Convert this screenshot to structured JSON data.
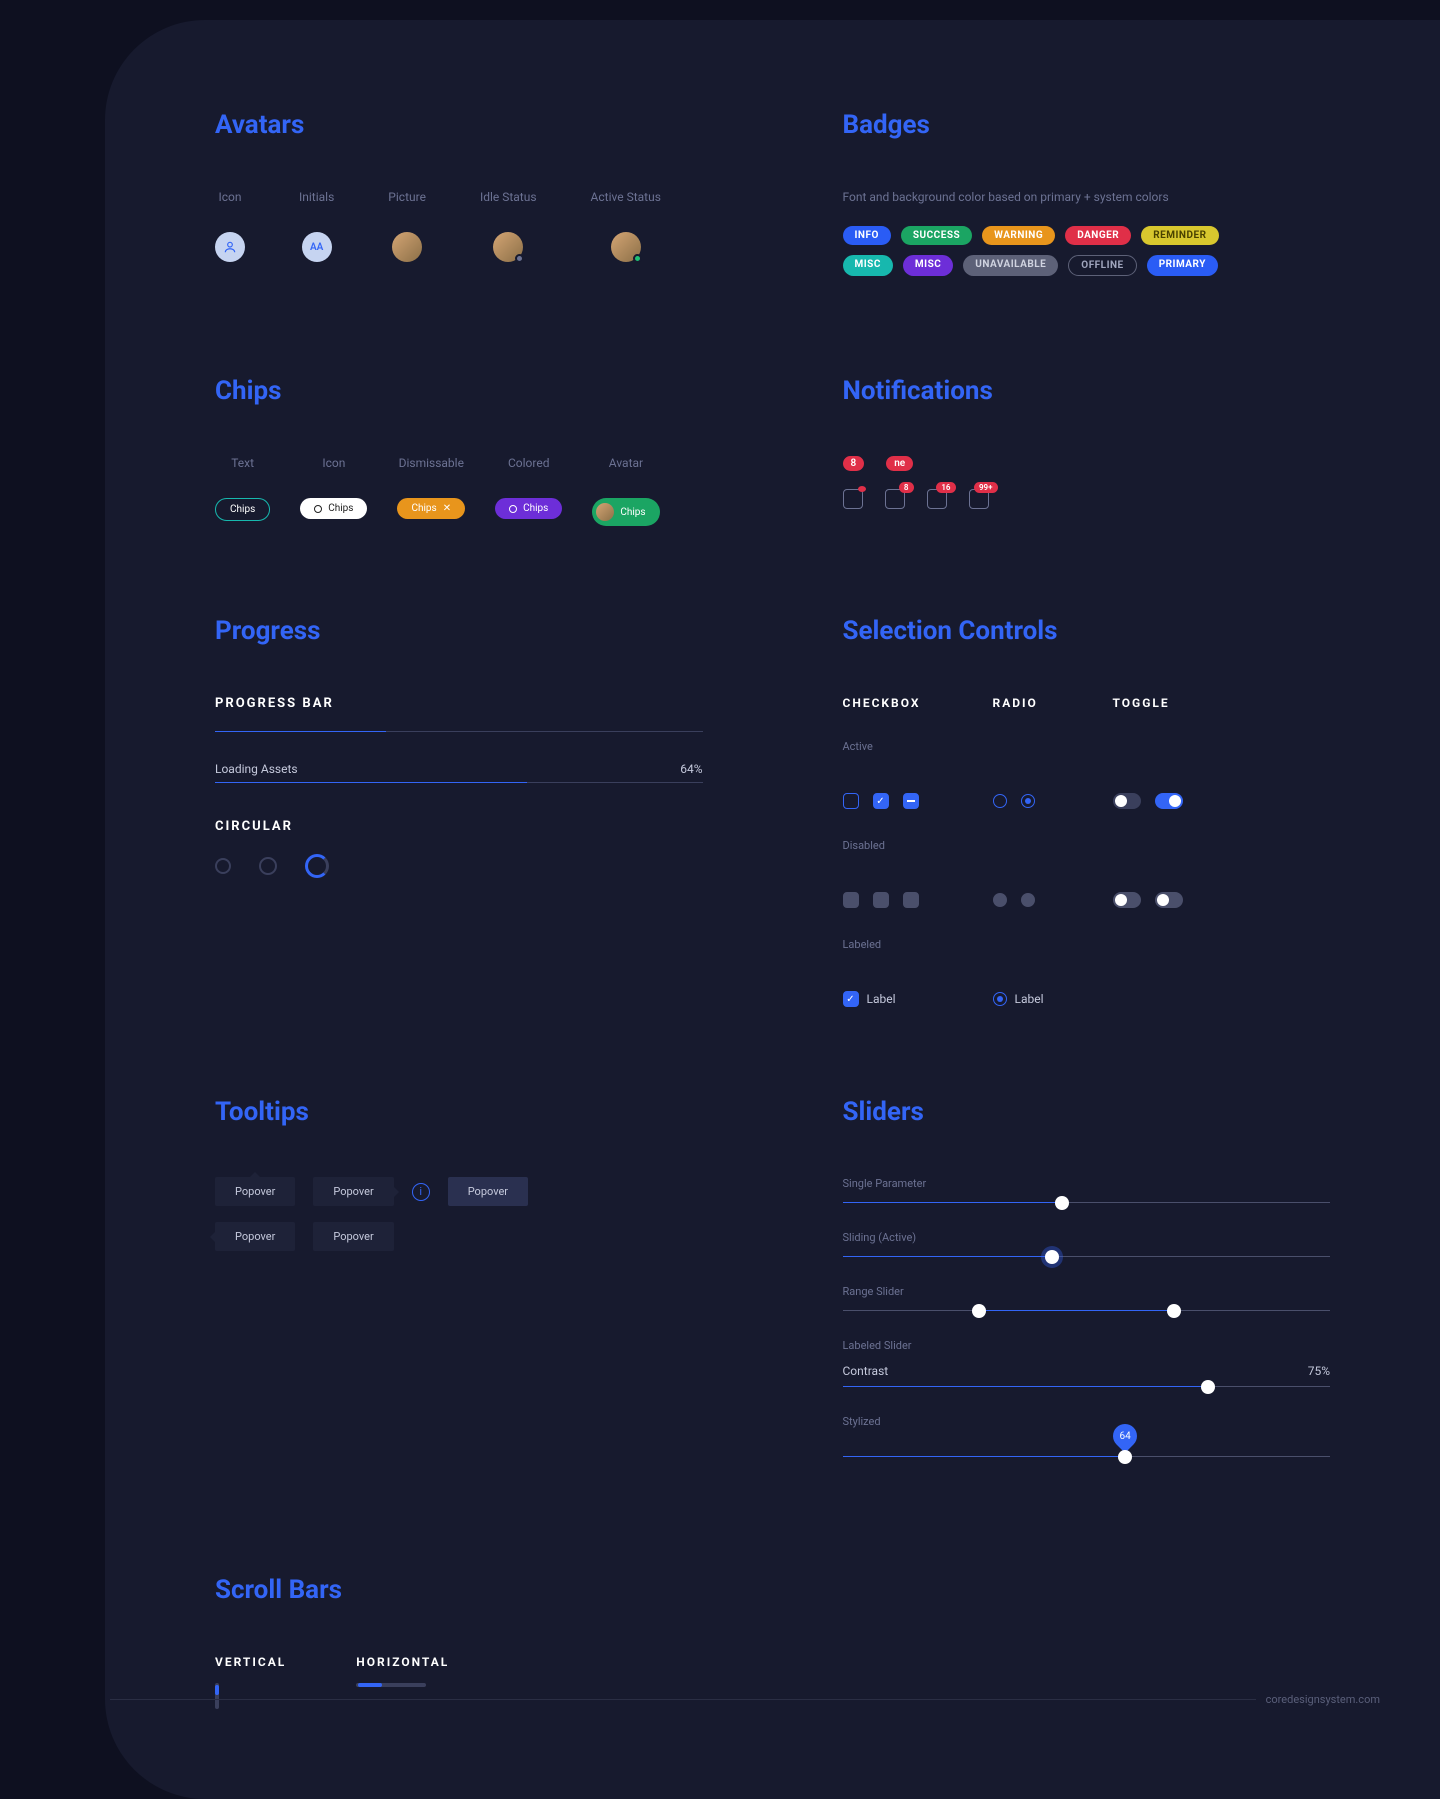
{
  "avatars": {
    "title": "Avatars",
    "variants": {
      "icon": "Icon",
      "initials": "Initials",
      "initials_text": "AA",
      "picture": "Picture",
      "idle_status": "Idle Status",
      "active_status": "Active Status"
    }
  },
  "badges": {
    "title": "Badges",
    "note": "Font and background color based on primary + system colors",
    "items": {
      "info": "INFO",
      "success": "SUCCESS",
      "warning": "WARNING",
      "danger": "DANGER",
      "reminder": "REMINDER",
      "misc": "MISC",
      "misc2": "MISC",
      "unavailable": "UNAVAILABLE",
      "offline": "OFFLINE",
      "primary": "PRIMARY"
    }
  },
  "chips": {
    "title": "Chips",
    "variants": {
      "text": "Text",
      "icon": "Icon",
      "dismissable": "Dismissable",
      "colored": "Colored",
      "avatar": "Avatar"
    },
    "label": "Chips"
  },
  "notifications": {
    "title": "Notifications",
    "counts": {
      "pill1": "8",
      "pill2": "ne",
      "b1": "8",
      "b2": "16",
      "b3": "99+"
    }
  },
  "progress": {
    "title": "Progress",
    "bar_heading": "PROGRESS BAR",
    "loading_label": "Loading Assets",
    "loading_value": "64%",
    "circular_heading": "CIRCULAR",
    "bar1_percent": 35,
    "bar2_percent": 64
  },
  "selection": {
    "title": "Selection Controls",
    "headers": {
      "checkbox": "CHECKBOX",
      "radio": "RADIO",
      "toggle": "TOGGLE"
    },
    "states": {
      "active": "Active",
      "disabled": "Disabled",
      "labeled": "Labeled"
    },
    "label_text": "Label"
  },
  "tooltips": {
    "title": "Tooltips",
    "label": "Popover"
  },
  "sliders": {
    "title": "Sliders",
    "single": {
      "label": "Single Parameter",
      "percent": 45
    },
    "sliding": {
      "label": "Sliding (Active)",
      "percent": 43
    },
    "range": {
      "label": "Range Slider",
      "start": 28,
      "end": 68
    },
    "labeled": {
      "label": "Labeled Slider",
      "name": "Contrast",
      "value": "75%",
      "percent": 75
    },
    "stylized": {
      "label": "Stylized",
      "percent": 58,
      "pin": "64"
    }
  },
  "scrollbars": {
    "title": "Scroll Bars",
    "vertical": "VERTICAL",
    "horizontal": "HORIZONTAL"
  },
  "footer": {
    "url": "coredesignsystem.com"
  }
}
